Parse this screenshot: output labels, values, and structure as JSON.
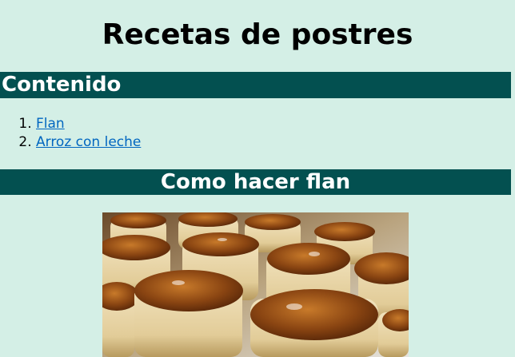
{
  "page": {
    "title": "Recetas de postres"
  },
  "contents": {
    "heading": "Contenido",
    "items": [
      {
        "label": "Flan"
      },
      {
        "label": "Arroz con leche"
      }
    ]
  },
  "flan_section": {
    "heading": "Como hacer flan"
  },
  "colors": {
    "background": "#d4efe6",
    "heading_bar": "#035050",
    "link": "#0066c0"
  }
}
